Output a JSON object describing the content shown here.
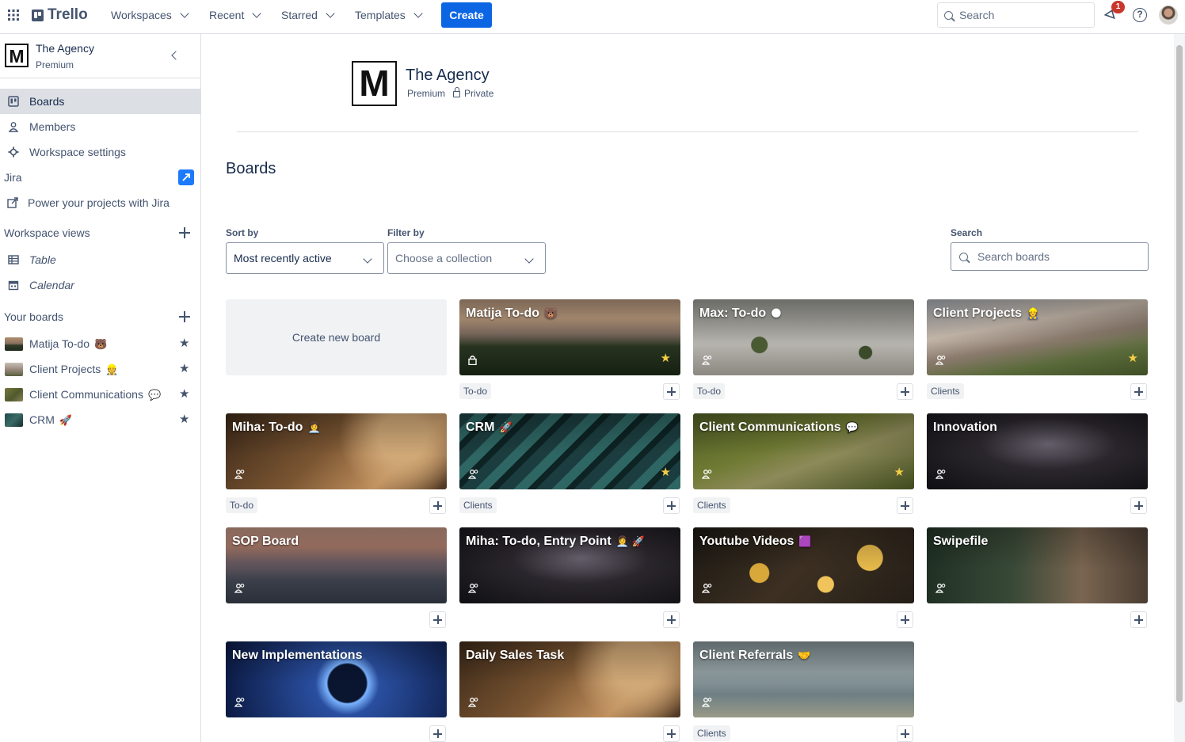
{
  "topbar": {
    "logo": "Trello",
    "menus": [
      "Workspaces",
      "Recent",
      "Starred",
      "Templates"
    ],
    "create_label": "Create",
    "search_placeholder": "Search",
    "notification_count": "1",
    "help_label": "?"
  },
  "sidebar": {
    "workspace_logo": "M",
    "workspace_name": "The Agency",
    "workspace_plan": "Premium",
    "nav": [
      {
        "label": "Boards",
        "icon": "board-icon",
        "active": true
      },
      {
        "label": "Members",
        "icon": "person-icon"
      },
      {
        "label": "Workspace settings",
        "icon": "gear-icon"
      }
    ],
    "jira_section": "Jira",
    "jira_link": "Power your projects with Jira",
    "views_section": "Workspace views",
    "views": [
      {
        "label": "Table",
        "icon": "table-icon"
      },
      {
        "label": "Calendar",
        "icon": "calendar-icon"
      }
    ],
    "your_boards_section": "Your boards",
    "boards": [
      {
        "label": "Matija To-do",
        "emoji": "🐻",
        "thumb": "mountains"
      },
      {
        "label": "Client Projects",
        "emoji": "👷",
        "thumb": "alps"
      },
      {
        "label": "Client Communications",
        "emoji": "💬",
        "thumb": "valley"
      },
      {
        "label": "CRM",
        "emoji": "🚀",
        "thumb": "teal"
      }
    ]
  },
  "header": {
    "logo": "M",
    "name": "The Agency",
    "plan": "Premium",
    "visibility": "Private"
  },
  "boards_title": "Boards",
  "filters": {
    "sort_label": "Sort by",
    "sort_value": "Most recently active",
    "filter_label": "Filter by",
    "filter_placeholder": "Choose a collection",
    "search_label": "Search",
    "search_placeholder": "Search boards"
  },
  "create_board_label": "Create new board",
  "board_tiles": [
    {
      "title": "Matija To-do",
      "emoji": "🐻",
      "bg": "mountains",
      "visibility": "private",
      "starred": true,
      "collection": "To-do"
    },
    {
      "title": "Max: To-do",
      "emoji": "🌑",
      "bg": "palms",
      "visibility": "workspace",
      "starred": false,
      "collection": "To-do"
    },
    {
      "title": "Client Projects",
      "emoji": "👷",
      "bg": "alps",
      "visibility": "workspace",
      "starred": true,
      "collection": "Clients"
    },
    {
      "title": "Miha: To-do",
      "emoji": "👩‍💼",
      "bg": "wheat",
      "visibility": "workspace",
      "starred": false,
      "collection": "To-do"
    },
    {
      "title": "CRM",
      "emoji": "🚀",
      "bg": "teal",
      "visibility": "workspace",
      "starred": true,
      "collection": "Clients"
    },
    {
      "title": "Client Communications",
      "emoji": "💬",
      "bg": "valley",
      "visibility": "workspace",
      "starred": true,
      "collection": "Clients"
    },
    {
      "title": "Innovation",
      "emoji": "",
      "bg": "milky",
      "visibility": "workspace",
      "starred": false,
      "collection": ""
    },
    {
      "title": "SOP Board",
      "emoji": "",
      "bg": "peaks",
      "visibility": "workspace",
      "starred": false,
      "collection": ""
    },
    {
      "title": "Miha: To-do, Entry Point",
      "emoji": "👩‍💼 🚀",
      "bg": "milky",
      "visibility": "workspace",
      "starred": false,
      "collection": ""
    },
    {
      "title": "Youtube Videos",
      "emoji": "🟪",
      "bg": "bubbles",
      "visibility": "workspace",
      "starred": false,
      "collection": ""
    },
    {
      "title": "Swipefile",
      "emoji": "",
      "bg": "eagle",
      "visibility": "workspace",
      "starred": false,
      "collection": ""
    },
    {
      "title": "New Implementations",
      "emoji": "",
      "bg": "eclipse",
      "visibility": "workspace",
      "starred": false,
      "collection": ""
    },
    {
      "title": "Daily Sales Task",
      "emoji": "",
      "bg": "wheat",
      "visibility": "workspace",
      "starred": false,
      "collection": ""
    },
    {
      "title": "Client Referrals",
      "emoji": "🤝",
      "bg": "sea",
      "visibility": "workspace",
      "starred": false,
      "collection": "Clients"
    }
  ],
  "colors": {
    "accent": "#0c66e4",
    "star": "#f5cd47",
    "badge": "#c9372c"
  }
}
